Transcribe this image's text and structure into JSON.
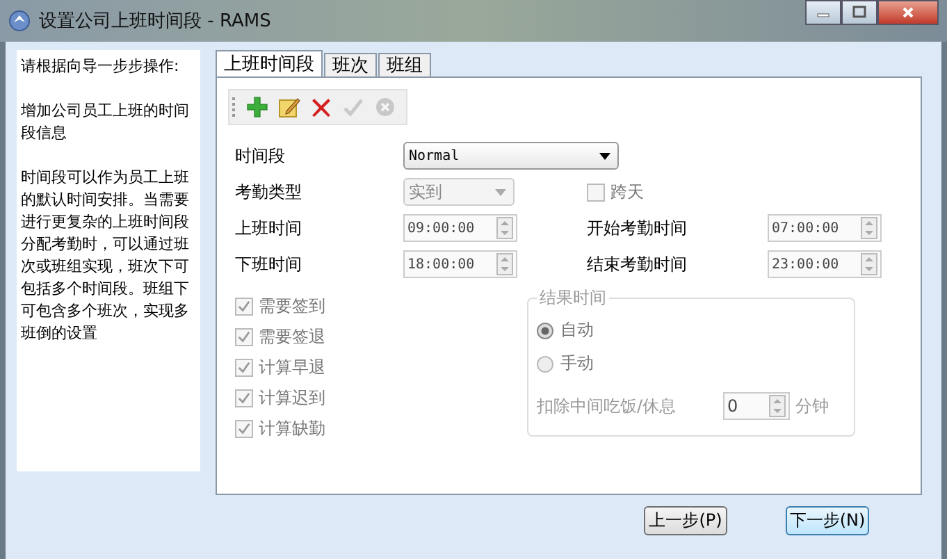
{
  "window": {
    "title": "设置公司上班时间段 - RAMS"
  },
  "guide": {
    "heading": "请根据向导一步步操作:",
    "paragraphs": [
      "增加公司员工上班的时间段信息",
      "时间段可以作为员工上班的默认时间安排。当需要进行更复杂的上班时间段分配考勤时，可以通过班次或班组实现，班次下可包括多个时间段。班组下可包含多个班次，实现多班倒的设置"
    ]
  },
  "tabs": [
    {
      "label": "上班时间段",
      "selected": true
    },
    {
      "label": "班次",
      "selected": false
    },
    {
      "label": "班组",
      "selected": false
    }
  ],
  "toolbar": [
    {
      "kind": "add",
      "disabled": false
    },
    {
      "kind": "edit",
      "disabled": false
    },
    {
      "kind": "delete",
      "disabled": false
    },
    {
      "kind": "confirm",
      "disabled": true
    },
    {
      "kind": "cancel",
      "disabled": true
    }
  ],
  "time_segment": {
    "label": "时间段",
    "value": "Normal"
  },
  "attendance_type": {
    "label": "考勤类型",
    "value": "实到",
    "disabled": true
  },
  "cross_day": {
    "label": "跨天",
    "checked": false,
    "disabled": true
  },
  "times": [
    {
      "label": "上班时间",
      "value": "09:00:00",
      "disabled": true
    },
    {
      "label": "开始考勤时间",
      "value": "07:00:00",
      "disabled": true
    },
    {
      "label": "下班时间",
      "value": "18:00:00",
      "disabled": true
    },
    {
      "label": "结束考勤时间",
      "value": "23:00:00",
      "disabled": true
    }
  ],
  "options": [
    {
      "label": "需要签到",
      "checked": true,
      "disabled": true
    },
    {
      "label": "需要签退",
      "checked": true,
      "disabled": true
    },
    {
      "label": "计算早退",
      "checked": true,
      "disabled": true
    },
    {
      "label": "计算迟到",
      "checked": true,
      "disabled": true
    },
    {
      "label": "计算缺勤",
      "checked": true,
      "disabled": true
    }
  ],
  "result_time": {
    "title": "结果时间",
    "radios": [
      {
        "label": "自动",
        "selected": true
      },
      {
        "label": "手动",
        "selected": false
      }
    ],
    "deduct": {
      "label": "扣除中间吃饭/休息",
      "value": "0",
      "unit": "分钟"
    }
  },
  "buttons": [
    {
      "label": "上一步(P)",
      "focused": false
    },
    {
      "label": "下一步(N)",
      "focused": true
    }
  ]
}
